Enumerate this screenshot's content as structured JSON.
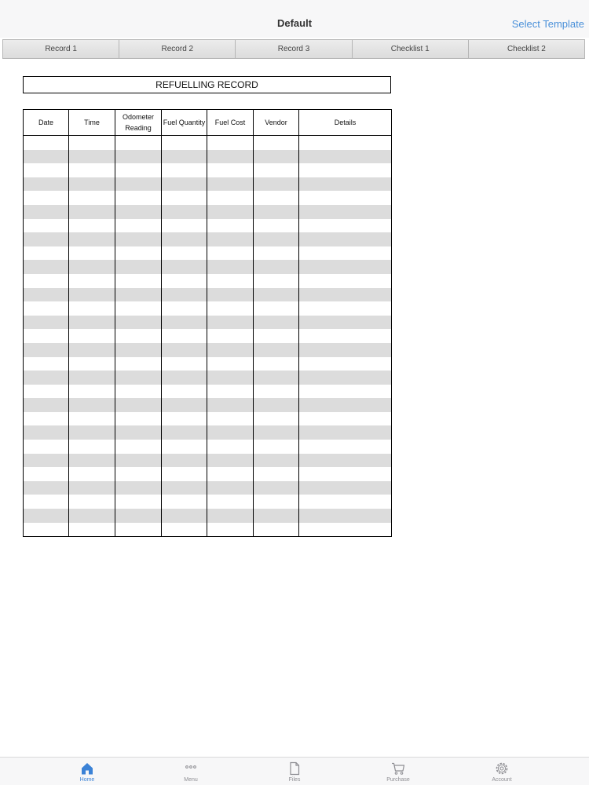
{
  "navbar": {
    "title": "Default",
    "action_label": "Select Template"
  },
  "tabs": [
    {
      "label": "Record 1"
    },
    {
      "label": "Record 2"
    },
    {
      "label": "Record 3"
    },
    {
      "label": "Checklist 1"
    },
    {
      "label": "Checklist 2"
    }
  ],
  "document": {
    "title": "REFUELLING RECORD",
    "columns": [
      "Date",
      "Time",
      "Odometer Reading",
      "Fuel Quantity",
      "Fuel Cost",
      "Vendor",
      "Details"
    ],
    "row_count": 29
  },
  "bottom_bar": [
    {
      "label": "Home",
      "icon": "home-icon",
      "active": true
    },
    {
      "label": "Menu",
      "icon": "more-icon",
      "active": false
    },
    {
      "label": "Files",
      "icon": "file-icon",
      "active": false
    },
    {
      "label": "Purchase",
      "icon": "cart-icon",
      "active": false
    },
    {
      "label": "Account",
      "icon": "gear-icon",
      "active": false
    }
  ],
  "colors": {
    "accent": "#4a90d9",
    "active_tab_icon": "#3b82d6",
    "row_stripe": "#dcdcdc"
  }
}
